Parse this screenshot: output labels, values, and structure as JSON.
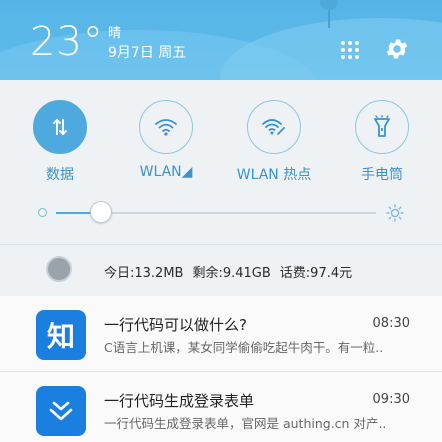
{
  "header": {
    "temperature": "23°",
    "weather": "晴",
    "date": "9月7日 周五",
    "icons": {
      "menu": "app-grid-icon",
      "settings": "gear-icon"
    }
  },
  "quick_toggles": [
    {
      "label": "数据",
      "icon": "data-transfer-icon",
      "active": true
    },
    {
      "label": "WLAN◢",
      "icon": "wifi-icon",
      "active": false
    },
    {
      "label": "WLAN 热点",
      "icon": "wifi-hotspot-icon",
      "active": false
    },
    {
      "label": "手电筒",
      "icon": "flashlight-icon",
      "active": false
    }
  ],
  "brightness": {
    "level": 0.14
  },
  "stats": {
    "today": "今日:13.2MB",
    "remaining": "剩余:9.41GB",
    "balance": "话费:97.4元"
  },
  "notifications": [
    {
      "app_icon_text": "知",
      "title": "一行代码可以做什么?",
      "time": "08:30",
      "body": "C语言上机课，某女同学偷偷吃起牛肉干。有一粒.."
    },
    {
      "app_icon_text": "",
      "title": "一行代码生成登录表单",
      "time": "09:30",
      "body": "一行代码生成登录表单，官网是 authing.cn 对产.."
    }
  ],
  "colors": {
    "accent": "#4eaade",
    "header_bg": "#5ab7e8",
    "toggle_label": "#3a93cd",
    "app_icon_bg": "#1b7fe0"
  }
}
